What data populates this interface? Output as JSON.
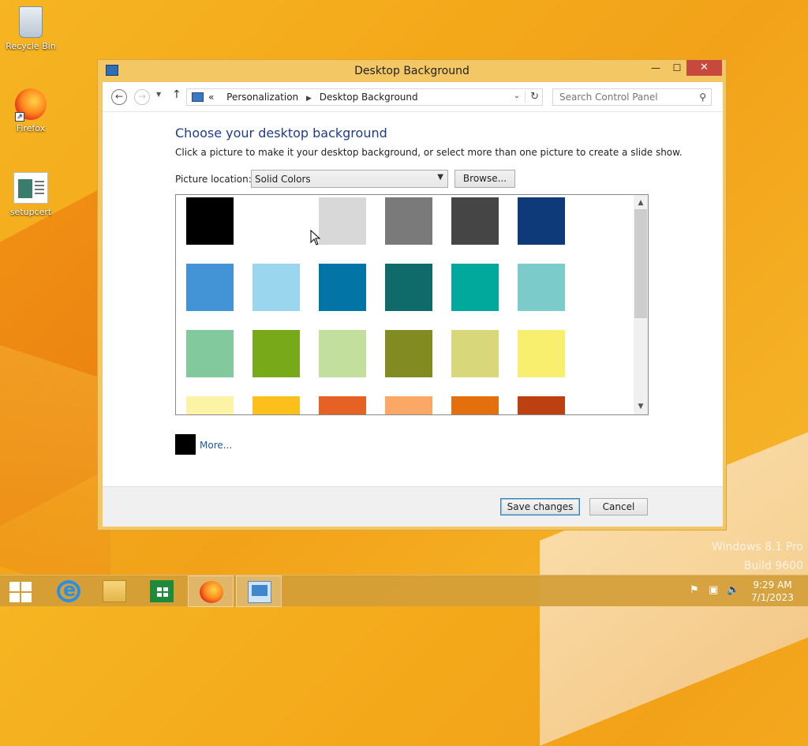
{
  "desktop": {
    "icons": [
      {
        "label": "Recycle Bin",
        "icon": "recycle-bin-icon"
      },
      {
        "label": "Firefox",
        "icon": "firefox-icon"
      },
      {
        "label": "setupcert",
        "icon": "document-icon"
      }
    ],
    "watermark": {
      "line1": "Windows 8.1 Pro",
      "line2": "Build 9600"
    }
  },
  "window": {
    "title": "Desktop Background",
    "controls": {
      "minimize": "—",
      "maximize": "☐",
      "close": "✕"
    }
  },
  "nav": {
    "back": "←",
    "forward": "→",
    "breadcrumb_prefix": "«",
    "breadcrumbs": [
      "Personalization",
      "Desktop Background"
    ],
    "search_placeholder": "Search Control Panel"
  },
  "content": {
    "heading": "Choose your desktop background",
    "description": "Click a picture to make it your desktop background, or select more than one picture to create a slide show.",
    "location_label": "Picture location:",
    "location_value": "Solid Colors",
    "browse_label": "Browse...",
    "more_label": "More..."
  },
  "swatches": [
    [
      "#000000",
      "#ffffff",
      "#d8d8d8",
      "#7a7a7a",
      "#454545",
      "#0e3a79"
    ],
    [
      "#4294d6",
      "#9ad6ed",
      "#0274a6",
      "#0f6a6a",
      "#01a99c",
      "#7ccbcb"
    ],
    [
      "#83c99e",
      "#77a919",
      "#c2df9e",
      "#828b22",
      "#d8d77a",
      "#f8ef6e"
    ],
    [
      "#fdf3a4",
      "#fcbf1c",
      "#e66224",
      "#fba867",
      "#e3700c",
      "#bd4010"
    ]
  ],
  "footer": {
    "save_label": "Save changes",
    "cancel_label": "Cancel"
  },
  "taskbar": {
    "apps": [
      "start",
      "internet-explorer",
      "file-explorer",
      "store",
      "firefox",
      "control-panel"
    ],
    "active": [
      "firefox",
      "control-panel"
    ],
    "time": "9:29 AM",
    "date": "7/1/2023"
  }
}
